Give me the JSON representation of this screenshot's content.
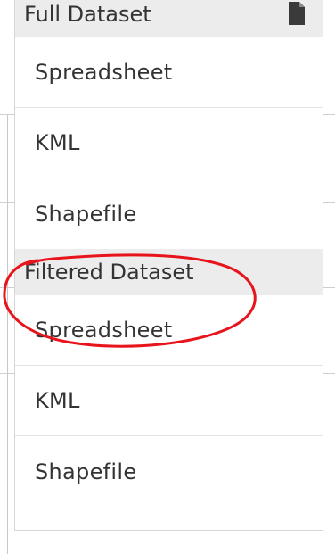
{
  "full_dataset": {
    "header": "Full Dataset",
    "icon": "file-icon",
    "items": [
      "Spreadsheet",
      "KML",
      "Shapefile"
    ]
  },
  "filtered_dataset": {
    "header": "Filtered Dataset",
    "items": [
      "Spreadsheet",
      "KML",
      "Shapefile"
    ]
  },
  "colors": {
    "header_bg": "#ececec",
    "text": "#333333",
    "annotation": "#e8141c"
  }
}
